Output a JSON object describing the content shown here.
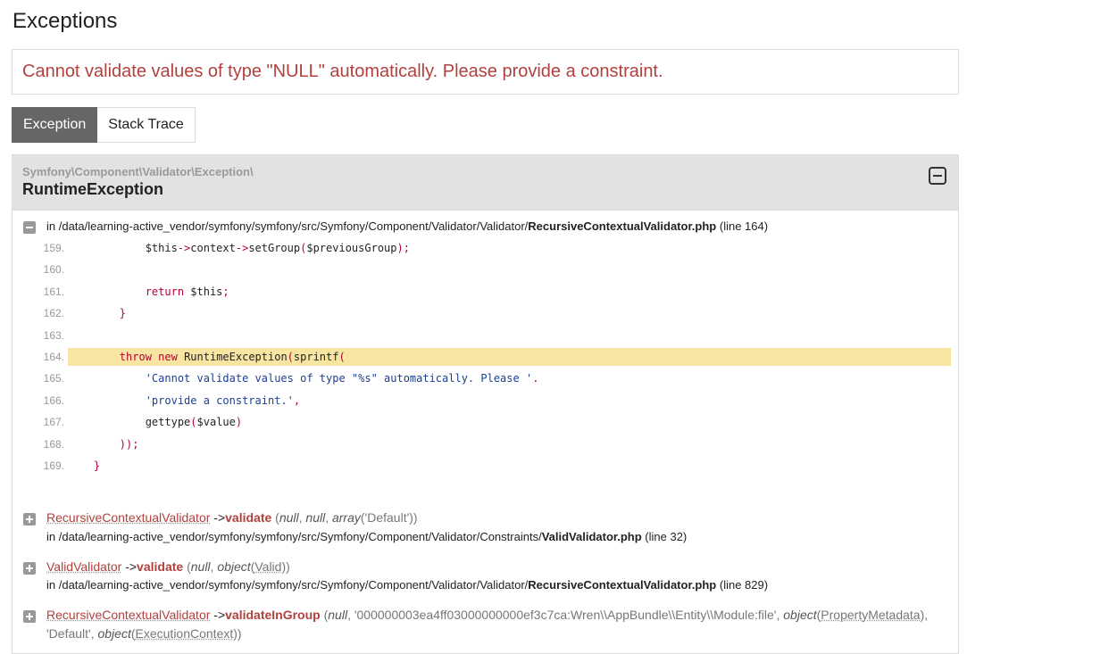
{
  "page": {
    "title": "Exceptions"
  },
  "message": "Cannot validate values of type \"NULL\" automatically. Please provide a constraint.",
  "tabs": [
    {
      "label": "Exception",
      "active": true
    },
    {
      "label": "Stack Trace",
      "active": false
    }
  ],
  "exception": {
    "namespace": "Symfony\\Component\\Validator\\Exception\\",
    "class": "RuntimeException",
    "file_prefix": "in /data/learning-active_vendor/symfony/symfony/src/Symfony/Component/Validator/Validator/",
    "file_name": "RecursiveContextualValidator.php",
    "line_info": "(line 164)"
  },
  "code": [
    {
      "n": "159.",
      "text": "            $this->context->setGroup($previousGroup);"
    },
    {
      "n": "160.",
      "text": ""
    },
    {
      "n": "161.",
      "text": "            return $this;"
    },
    {
      "n": "162.",
      "text": "        }"
    },
    {
      "n": "163.",
      "text": ""
    },
    {
      "n": "164.",
      "text": "        throw new RuntimeException(sprintf(",
      "selected": true
    },
    {
      "n": "165.",
      "text": "            'Cannot validate values of type \"%s\" automatically. Please '."
    },
    {
      "n": "166.",
      "text": "            'provide a constraint.',"
    },
    {
      "n": "167.",
      "text": "            gettype($value)"
    },
    {
      "n": "168.",
      "text": "        ));"
    },
    {
      "n": "169.",
      "text": "    }"
    }
  ],
  "frames": [
    {
      "class": "RecursiveContextualValidator",
      "arrow": "->",
      "method": "validate",
      "args_open": "(",
      "args": "null, null, array('Default'))",
      "file_prefix": "in /data/learning-active_vendor/symfony/symfony/src/Symfony/Component/Validator/Constraints/",
      "file_name": "ValidValidator.php",
      "line_info": "(line 32)"
    },
    {
      "class": "ValidValidator",
      "arrow": "->",
      "method": "validate",
      "args_open": "(",
      "args": "null, object(Valid))",
      "file_prefix": "in /data/learning-active_vendor/symfony/symfony/src/Symfony/Component/Validator/Validator/",
      "file_name": "RecursiveContextualValidator.php",
      "line_info": "(line 829)"
    },
    {
      "class": "RecursiveContextualValidator",
      "arrow": "->",
      "method": "validateInGroup",
      "args_open": "(",
      "args": "null, '000000003ea4ff03000000000ef3c7ca:Wren\\\\AppBundle\\\\Entity\\\\Module:file', object(PropertyMetadata),",
      "args_cont": "'Default', object(ExecutionContext))"
    }
  ]
}
